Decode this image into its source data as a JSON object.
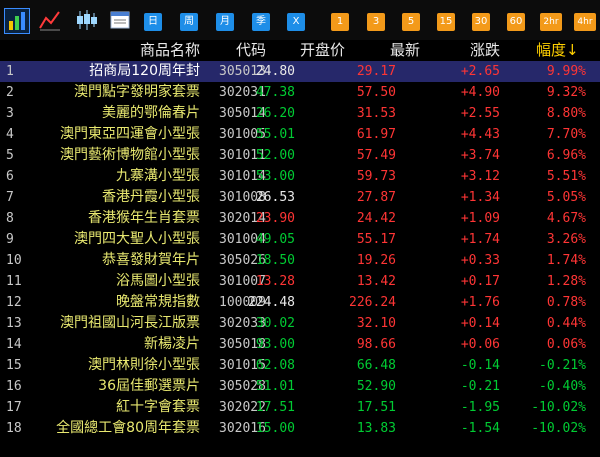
{
  "toolbar": {
    "buttons": [
      {
        "label": "日",
        "color": "blue"
      },
      {
        "label": "周",
        "color": "blue"
      },
      {
        "label": "月",
        "color": "blue"
      },
      {
        "label": "季",
        "color": "blue"
      },
      {
        "label": "X",
        "color": "blue"
      },
      {
        "label": "1",
        "color": "orange"
      },
      {
        "label": "3",
        "color": "orange"
      },
      {
        "label": "5",
        "color": "orange"
      },
      {
        "label": "15",
        "color": "orange"
      },
      {
        "label": "30",
        "color": "orange"
      },
      {
        "label": "60",
        "color": "orange"
      },
      {
        "label": "2hr",
        "color": "orange"
      },
      {
        "label": "4hr",
        "color": "orange"
      }
    ]
  },
  "table": {
    "headers": {
      "name": "商品名称",
      "code": "代码",
      "open": "开盘价",
      "last": "最新",
      "change": "涨跌",
      "change_pct": "幅度↓"
    },
    "rows": [
      {
        "idx": "1",
        "name": "招商局120周年封",
        "code": "305013",
        "open": "24.80",
        "last": "29.17",
        "change": "+2.65",
        "pct": "9.99%",
        "open_dir": "flat",
        "last_dir": "up",
        "dir": "up"
      },
      {
        "idx": "2",
        "name": "澳門點字發明家套票",
        "code": "302031",
        "open": "47.38",
        "last": "57.50",
        "change": "+4.90",
        "pct": "9.32%",
        "open_dir": "down",
        "last_dir": "up",
        "dir": "up"
      },
      {
        "idx": "3",
        "name": "美麗的鄂倫春片",
        "code": "305014",
        "open": "26.20",
        "last": "31.53",
        "change": "+2.55",
        "pct": "8.80%",
        "open_dir": "down",
        "last_dir": "up",
        "dir": "up"
      },
      {
        "idx": "4",
        "name": "澳門東亞四運會小型張",
        "code": "301005",
        "open": "55.01",
        "last": "61.97",
        "change": "+4.43",
        "pct": "7.70%",
        "open_dir": "down",
        "last_dir": "up",
        "dir": "up"
      },
      {
        "idx": "5",
        "name": "澳門藝術博物館小型張",
        "code": "301011",
        "open": "52.00",
        "last": "57.49",
        "change": "+3.74",
        "pct": "6.96%",
        "open_dir": "down",
        "last_dir": "up",
        "dir": "up"
      },
      {
        "idx": "6",
        "name": "九寨溝小型張",
        "code": "301014",
        "open": "53.00",
        "last": "59.73",
        "change": "+3.12",
        "pct": "5.51%",
        "open_dir": "down",
        "last_dir": "up",
        "dir": "up"
      },
      {
        "idx": "7",
        "name": "香港丹霞小型張",
        "code": "301008",
        "open": "26.53",
        "last": "27.87",
        "change": "+1.34",
        "pct": "5.05%",
        "open_dir": "flat",
        "last_dir": "up",
        "dir": "up"
      },
      {
        "idx": "8",
        "name": "香港猴年生肖套票",
        "code": "302014",
        "open": "23.90",
        "last": "24.42",
        "change": "+1.09",
        "pct": "4.67%",
        "open_dir": "up",
        "last_dir": "up",
        "dir": "up"
      },
      {
        "idx": "9",
        "name": "澳門四大聖人小型張",
        "code": "301004",
        "open": "49.05",
        "last": "55.17",
        "change": "+1.74",
        "pct": "3.26%",
        "open_dir": "down",
        "last_dir": "up",
        "dir": "up"
      },
      {
        "idx": "10",
        "name": "恭喜發財賀年片",
        "code": "305026",
        "open": "18.50",
        "last": "19.26",
        "change": "+0.33",
        "pct": "1.74%",
        "open_dir": "down",
        "last_dir": "up",
        "dir": "up"
      },
      {
        "idx": "11",
        "name": "浴馬圖小型張",
        "code": "301007",
        "open": "13.28",
        "last": "13.42",
        "change": "+0.17",
        "pct": "1.28%",
        "open_dir": "up",
        "last_dir": "up",
        "dir": "up"
      },
      {
        "idx": "12",
        "name": "晚盤常規指數",
        "code": "100009",
        "open": "224.48",
        "last": "226.24",
        "change": "+1.76",
        "pct": "0.78%",
        "open_dir": "flat",
        "last_dir": "up",
        "dir": "up"
      },
      {
        "idx": "13",
        "name": "澳門祖國山河長江版票",
        "code": "302033",
        "open": "30.02",
        "last": "32.10",
        "change": "+0.14",
        "pct": "0.44%",
        "open_dir": "down",
        "last_dir": "up",
        "dir": "up"
      },
      {
        "idx": "14",
        "name": "新楊凌片",
        "code": "305018",
        "open": "93.00",
        "last": "98.66",
        "change": "+0.06",
        "pct": "0.06%",
        "open_dir": "down",
        "last_dir": "up",
        "dir": "up"
      },
      {
        "idx": "15",
        "name": "澳門林則徐小型張",
        "code": "301015",
        "open": "62.08",
        "last": "66.48",
        "change": "-0.14",
        "pct": "-0.21%",
        "open_dir": "down",
        "last_dir": "down",
        "dir": "down"
      },
      {
        "idx": "16",
        "name": "36屆佳郵選票片",
        "code": "305028",
        "open": "51.01",
        "last": "52.90",
        "change": "-0.21",
        "pct": "-0.40%",
        "open_dir": "down",
        "last_dir": "down",
        "dir": "down"
      },
      {
        "idx": "17",
        "name": "紅十字會套票",
        "code": "302022",
        "open": "17.51",
        "last": "17.51",
        "change": "-1.95",
        "pct": "-10.02%",
        "open_dir": "down",
        "last_dir": "down",
        "dir": "down"
      },
      {
        "idx": "18",
        "name": "全國總工會80周年套票",
        "code": "302016",
        "open": "15.00",
        "last": "13.83",
        "change": "-1.54",
        "pct": "-10.02%",
        "open_dir": "down",
        "last_dir": "down",
        "dir": "down"
      }
    ]
  },
  "colors": {
    "up": "#ff3535",
    "down": "#00cc33",
    "name": "#e8e870",
    "selected_row": "#26286a",
    "accent": "#1e8ee8",
    "orange": "#f39a1a"
  }
}
